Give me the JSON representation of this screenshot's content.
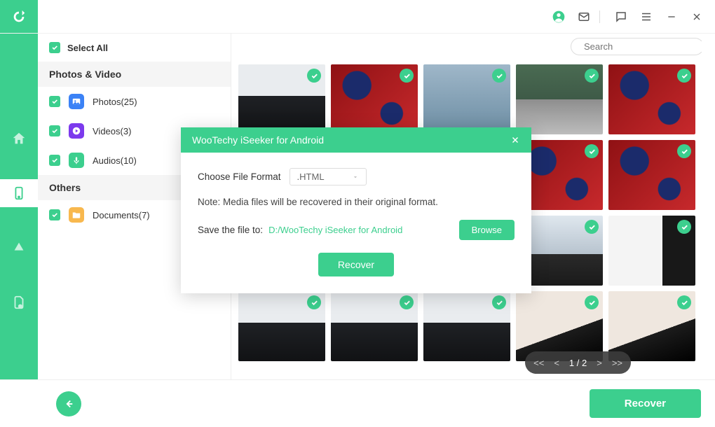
{
  "titlebar": {
    "account_icon": "account-icon",
    "mail_icon": "mail-icon",
    "feedback_icon": "feedback-icon",
    "menu_icon": "menu-icon",
    "minimize_icon": "minimize-icon",
    "close_icon": "close-icon"
  },
  "sidebar": {
    "select_all_label": "Select All",
    "sections": {
      "media": {
        "head": "Photos & Video",
        "items": [
          {
            "label": "Photos(25)",
            "icon": "photo",
            "color": "#3b82f6"
          },
          {
            "label": "Videos(3)",
            "icon": "video",
            "color": "#7c3aed"
          },
          {
            "label": "Audios(10)",
            "icon": "audio",
            "color": "#3ccf8e"
          }
        ]
      },
      "others": {
        "head": "Others",
        "items": [
          {
            "label": "Documents(7)",
            "icon": "folder",
            "color": "#f8b84e"
          }
        ]
      }
    }
  },
  "search": {
    "placeholder": "Search"
  },
  "thumbs": [
    "keyboard",
    "snack-red",
    "phone-back",
    "subway",
    "snack-red",
    "snack-red",
    "snack-red",
    "office-people",
    "monitor-side",
    "keyboard",
    "keyboard",
    "keyboard",
    "mouse-desk",
    "mouse-desk"
  ],
  "thumb_colors": {
    "keyboard": "linear-gradient(180deg,#e9ecef 0%, #e9ecef 45%, #1f2125 45%, #111214 100%)",
    "snack-red": "radial-gradient(circle at 30% 30%, #1b2b6b 0 18%, transparent 19%), radial-gradient(circle at 70% 70%, #1b2b6b 0 14%, transparent 15%), linear-gradient(135deg,#8f1114,#c7292c)",
    "phone-back": "linear-gradient(180deg,#9fb7c9,#6c8da3)",
    "subway": "linear-gradient(180deg,#4a6b52 0%, #3e5a47 50%, #8e8e8e 50%, #bcbcbc 100%)",
    "office-people": "linear-gradient(180deg,#dfe7ee 0%, #b8c4cf 55%, #2a2a2a 55%, #1a1a1a 100%)",
    "monitor-side": "linear-gradient(90deg,#f4f4f4 0%, #f4f4f4 62%, #181818 62%, #181818 100%)",
    "mouse-desk": "linear-gradient(160deg,#efe7df 0%, #efe7df 58%, #1c1c1c 58%, #000 100%)"
  },
  "pager": {
    "first": "<<",
    "prev": "<",
    "current": "1 / 2",
    "next": ">",
    "last": ">>"
  },
  "modal": {
    "title": "WooTechy iSeeker for Android",
    "choose_label": "Choose File Format",
    "format_value": ".HTML",
    "note": "Note: Media files will be recovered in their original format.",
    "save_label": "Save the file to:",
    "save_path": "D:/WooTechy iSeeker for Android",
    "browse_label": "Browse",
    "recover_label": "Recover"
  },
  "footer": {
    "recover_label": "Recover"
  }
}
